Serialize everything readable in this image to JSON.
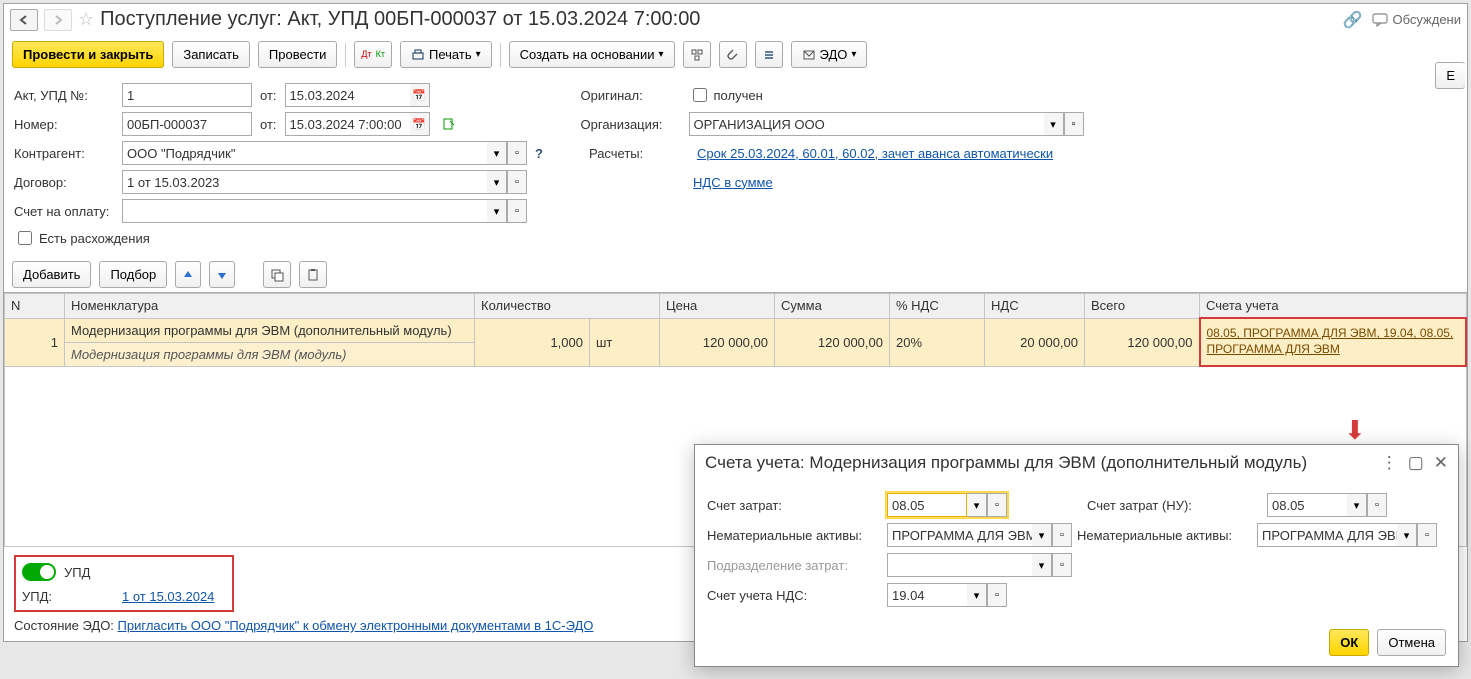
{
  "title": {
    "text": "Поступление услуг: Акт, УПД 00БП-000037 от 15.03.2024 7:00:00",
    "discuss_label": "Обсуждени"
  },
  "toolbar": {
    "post_close": "Провести и закрыть",
    "save": "Записать",
    "post": "Провести",
    "print": "Печать",
    "create_based": "Создать на основании",
    "edo": "ЭДО",
    "more": "Е"
  },
  "form": {
    "akt_label": "Акт, УПД №:",
    "akt_no": "1",
    "from_label": "от:",
    "akt_date": "15.03.2024",
    "number_label": "Номер:",
    "number": "00БП-000037",
    "number_date": "15.03.2024  7:00:00",
    "original_label": "Оригинал:",
    "received_label": "получен",
    "counterparty_label": "Контрагент:",
    "counterparty": "ООО \"Подрядчик\"",
    "org_label": "Организация:",
    "org": "ОРГАНИЗАЦИЯ ООО",
    "contract_label": "Договор:",
    "contract": "1 от 15.03.2023",
    "calc_label": "Расчеты:",
    "calc_link": "Срок 25.03.2024, 60.01, 60.02, зачет аванса автоматически",
    "vat_link": "НДС в сумме",
    "invoice_label": "Счет на оплату:",
    "discrepancy_label": "Есть расхождения"
  },
  "table_toolbar": {
    "add": "Добавить",
    "select": "Подбор"
  },
  "grid": {
    "headers": {
      "n": "N",
      "nomenclature": "Номенклатура",
      "qty": "Количество",
      "unit_implicit": "",
      "price": "Цена",
      "sum": "Сумма",
      "vat_pct": "% НДС",
      "vat": "НДС",
      "total": "Всего",
      "accounts": "Счета учета"
    },
    "row": {
      "n": "1",
      "name": "Модернизация программы для ЭВМ (дополнительный модуль)",
      "name2": "Модернизация программы для ЭВМ (модуль)",
      "qty": "1,000",
      "unit": "шт",
      "price": "120 000,00",
      "sum": "120 000,00",
      "vat_pct": "20%",
      "vat": "20 000,00",
      "total": "120 000,00",
      "accounts_link": "08.05, ПРОГРАММА ДЛЯ ЭВМ, 19.04, 08.05, ПРОГРАММА ДЛЯ ЭВМ"
    }
  },
  "footer": {
    "upd_toggle_label": "УПД",
    "upd_label": "УПД:",
    "upd_link": "1 от 15.03.2024",
    "edo_state_label": "Состояние ЭДО:",
    "edo_state_link": "Пригласить ООО \"Подрядчик\" к обмену электронными документами в 1С-ЭДО"
  },
  "popup": {
    "title": "Счета учета: Модернизация программы для ЭВМ (дополнительный модуль)",
    "rows": {
      "cost_acc_label": "Счет затрат:",
      "cost_acc": "08.05",
      "cost_acc_nu_label": "Счет затрат (НУ):",
      "cost_acc_nu": "08.05",
      "nma_label": "Нематериальные активы:",
      "nma": "ПРОГРАММА ДЛЯ ЭВМ",
      "nma2": "ПРОГРАММА ДЛЯ ЭВІ",
      "dept_label": "Подразделение затрат:",
      "vat_acc_label": "Счет учета НДС:",
      "vat_acc": "19.04"
    },
    "ok": "ОК",
    "cancel": "Отмена"
  }
}
